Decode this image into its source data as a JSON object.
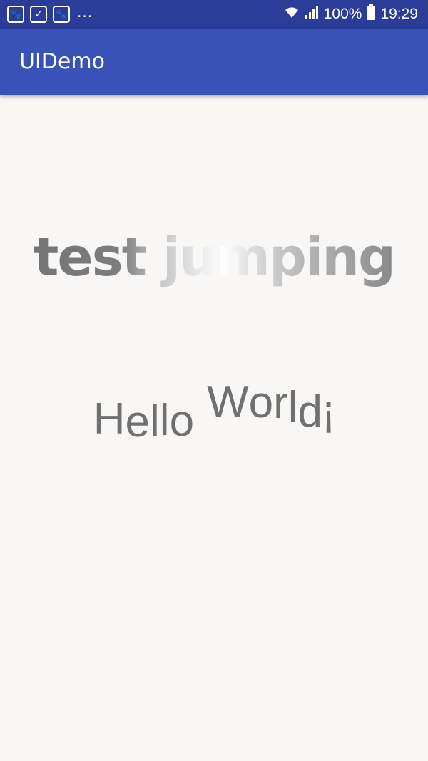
{
  "status_bar": {
    "notification_icons": [
      "baidu-paw-icon",
      "checklist-icon",
      "baidu-paw-icon"
    ],
    "more_indicator": "...",
    "battery_percent": "100%",
    "time": "19:29"
  },
  "app_bar": {
    "title": "UIDemo"
  },
  "content": {
    "jumping_text": "test jumping",
    "hello_letters": [
      "H",
      "e",
      "l",
      "l",
      "o",
      "W",
      "o",
      "r",
      "l",
      "d",
      "!"
    ],
    "colors": {
      "text_gray": "#707070",
      "app_bar": "#3852b8",
      "status_bar": "#2b3c99",
      "background": "#f8f7f5"
    }
  }
}
